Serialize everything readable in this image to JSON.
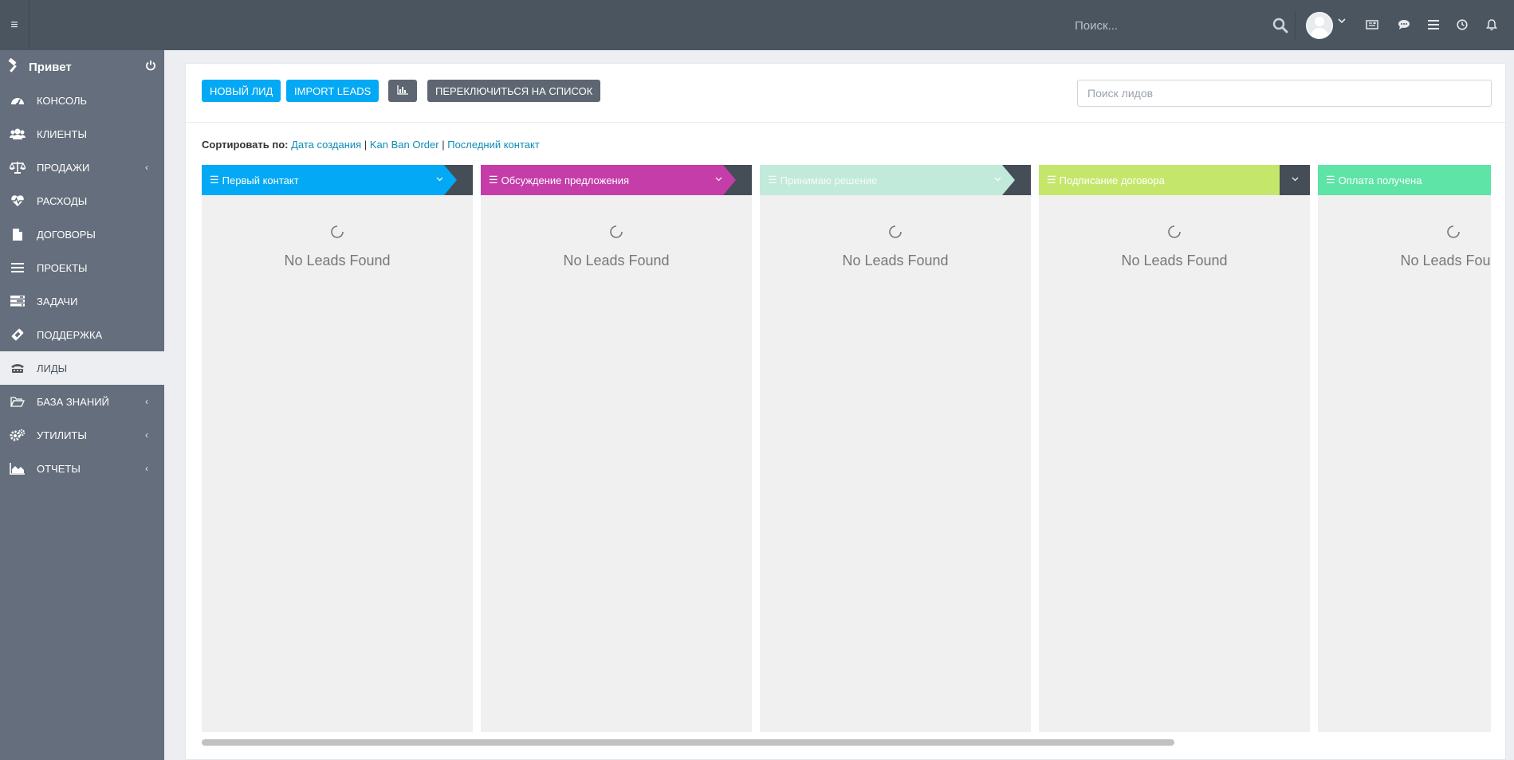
{
  "topbar": {
    "search_placeholder": "Поиск...",
    "icons": [
      "menu-icon",
      "search-icon",
      "avatar",
      "chevron-down-icon",
      "news-icon",
      "chat-icon",
      "list-icon",
      "clock-icon",
      "bell-icon"
    ]
  },
  "sidebar": {
    "greeting": "Привет",
    "items": [
      {
        "label": "КОНСОЛЬ",
        "icon": "dashboard-icon"
      },
      {
        "label": "КЛИЕНТЫ",
        "icon": "users-icon"
      },
      {
        "label": "ПРОДАЖИ",
        "icon": "balance-scale-icon",
        "arrow": "‹"
      },
      {
        "label": "РАСХОДЫ",
        "icon": "heartbeat-icon"
      },
      {
        "label": "ДОГОВОРЫ",
        "icon": "file-icon"
      },
      {
        "label": "ПРОЕКТЫ",
        "icon": "bars-icon"
      },
      {
        "label": "ЗАДАЧИ",
        "icon": "tasks-icon"
      },
      {
        "label": "ПОДДЕРЖКА",
        "icon": "ticket-icon"
      },
      {
        "label": "ЛИДЫ",
        "icon": "tty-icon"
      },
      {
        "label": "БАЗА ЗНАНИЙ",
        "icon": "folder-open-icon",
        "arrow": "‹"
      },
      {
        "label": "УТИЛИТЫ",
        "icon": "cogs-icon",
        "arrow": "‹"
      },
      {
        "label": "ОТЧЕТЫ",
        "icon": "area-chart-icon",
        "arrow": "‹"
      }
    ],
    "active": "ЛИДЫ"
  },
  "toolbar": {
    "new_lead": "НОВЫЙ ЛИД",
    "import_leads": "IMPORT LEADS",
    "switch_list": "ПЕРЕКЛЮЧИТЬСЯ НА СПИСОК",
    "search_placeholder": "Поиск лидов"
  },
  "sort": {
    "label": "Сортировать по:",
    "options": [
      "Дата создания",
      "Kan Ban Order",
      "Последний контакт"
    ],
    "separator": "|"
  },
  "columns": [
    {
      "title": "Первый контакт",
      "color": "#03a9f4",
      "text_color": "#ffffff",
      "empty": "No Leads Found"
    },
    {
      "title": "Обсуждение предложения",
      "color": "#c53da9",
      "text_color": "#ffffff",
      "empty": "No Leads Found"
    },
    {
      "title": "Принимаю решение",
      "color": "#c2eadb",
      "text_color": "#f4fbf8",
      "empty": "No Leads Found"
    },
    {
      "title": "Подписание договора",
      "color": "#c4e76b",
      "text_color": "#ffffff",
      "empty": "No Leads Found"
    },
    {
      "title": "Оплата получена",
      "color": "#5de4a6",
      "text_color": "#ffffff",
      "empty": "No Leads Found"
    }
  ],
  "colors": {
    "topbar": "#4b5560",
    "sidebar": "#646e7c",
    "accent": "#03a9f4",
    "link": "#0f8cb6"
  }
}
